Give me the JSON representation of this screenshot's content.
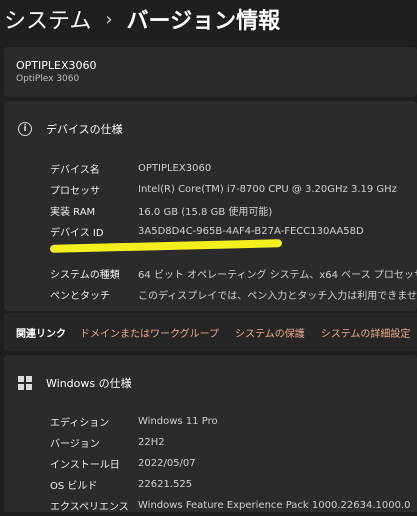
{
  "breadcrumb": {
    "parent": "システム",
    "separator": "›",
    "current": "バージョン情報"
  },
  "device": {
    "name": "OPTIPLEX3060",
    "model": "OptiPlex 3060"
  },
  "device_specs": {
    "title": "デバイスの仕様",
    "rows": [
      {
        "label": "デバイス名",
        "value": "OPTIPLEX3060"
      },
      {
        "label": "プロセッサ",
        "value": "Intel(R) Core(TM) i7-8700 CPU @ 3.20GHz   3.19 GHz"
      },
      {
        "label": "実装 RAM",
        "value": "16.0 GB (15.8 GB 使用可能)"
      },
      {
        "label": "デバイス ID",
        "value": "3A5D8D4C-965B-4AF4-B27A-FECC130AA58D"
      },
      {
        "label": "",
        "value": ""
      },
      {
        "label": "システムの種類",
        "value": "64 ビット オペレーティング システム、x64 ベース プロセッサ"
      },
      {
        "label": "ペンとタッチ",
        "value": "このディスプレイでは、ペン入力とタッチ入力は利用できません"
      }
    ]
  },
  "related_links": {
    "title": "関連リンク",
    "links": [
      "ドメインまたはワークグループ",
      "システムの保護",
      "システムの詳細設定"
    ]
  },
  "windows_specs": {
    "title": "Windows の仕様",
    "rows": [
      {
        "label": "エディション",
        "value": "Windows 11 Pro"
      },
      {
        "label": "バージョン",
        "value": "22H2"
      },
      {
        "label": "インストール日",
        "value": "2022/05/07"
      },
      {
        "label": "OS ビルド",
        "value": "22621.525"
      },
      {
        "label": "エクスペリエンス",
        "value": "Windows Feature Experience Pack 1000.22634.1000.0"
      }
    ]
  },
  "colors": {
    "background": "#1f1f1f",
    "card": "#2b2b2b",
    "link": "#f0a989",
    "highlight": "#f3f01d"
  }
}
